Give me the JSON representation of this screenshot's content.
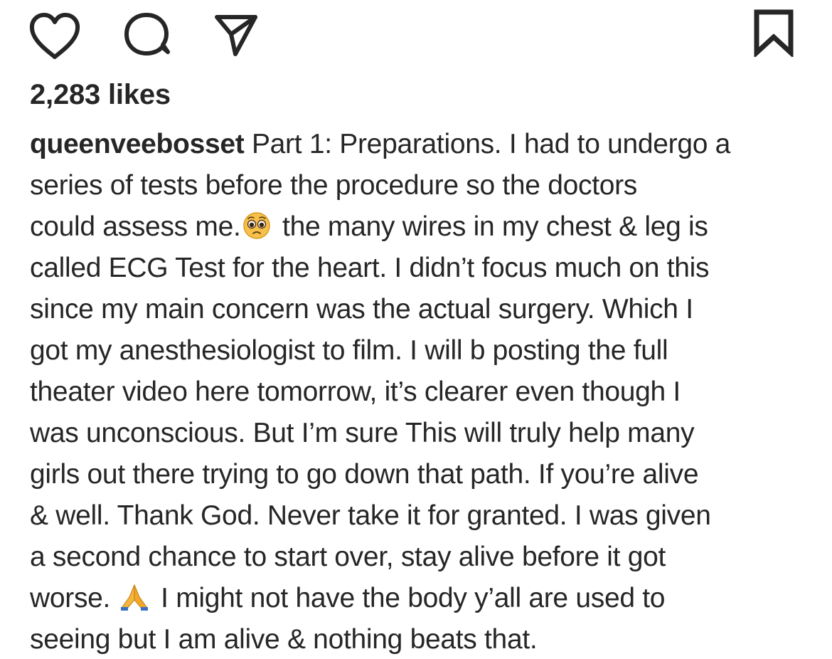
{
  "actions": {
    "like_icon": "heart-outline",
    "comment_icon": "speech-bubble",
    "share_icon": "paper-plane",
    "save_icon": "bookmark"
  },
  "post": {
    "likes": "2,283 likes",
    "username": "queenveebosset",
    "caption": {
      "line1": " Part 1: Preparations. I had to undergo a",
      "line2": "series of tests before the procedure so the doctors",
      "line3a": "could assess me.",
      "emoji1": "pleading-face",
      "line3b": " the many wires in my chest & leg is",
      "line4": "called ECG Test for the heart. I didn’t focus much on this",
      "line5": "since my main concern was the actual surgery. Which I",
      "line6": "got my anesthesiologist to film. I will b posting the full",
      "line7": "theater video here tomorrow, it’s clearer even though I",
      "line8": "was unconscious. But I’m sure This will truly help many",
      "line9": "girls out there trying to go down that path.  If you’re alive",
      "line10": "& well. Thank God. Never take it for granted. I was given",
      "line11": "a second chance to start over, stay alive before it got",
      "line12a": "worse. ",
      "emoji2": "folded-hands",
      "line12b": " I might not have the body y’all are used to",
      "line13": "seeing but I am alive & nothing beats that."
    }
  },
  "colors": {
    "text": "#262626",
    "background": "#ffffff"
  }
}
